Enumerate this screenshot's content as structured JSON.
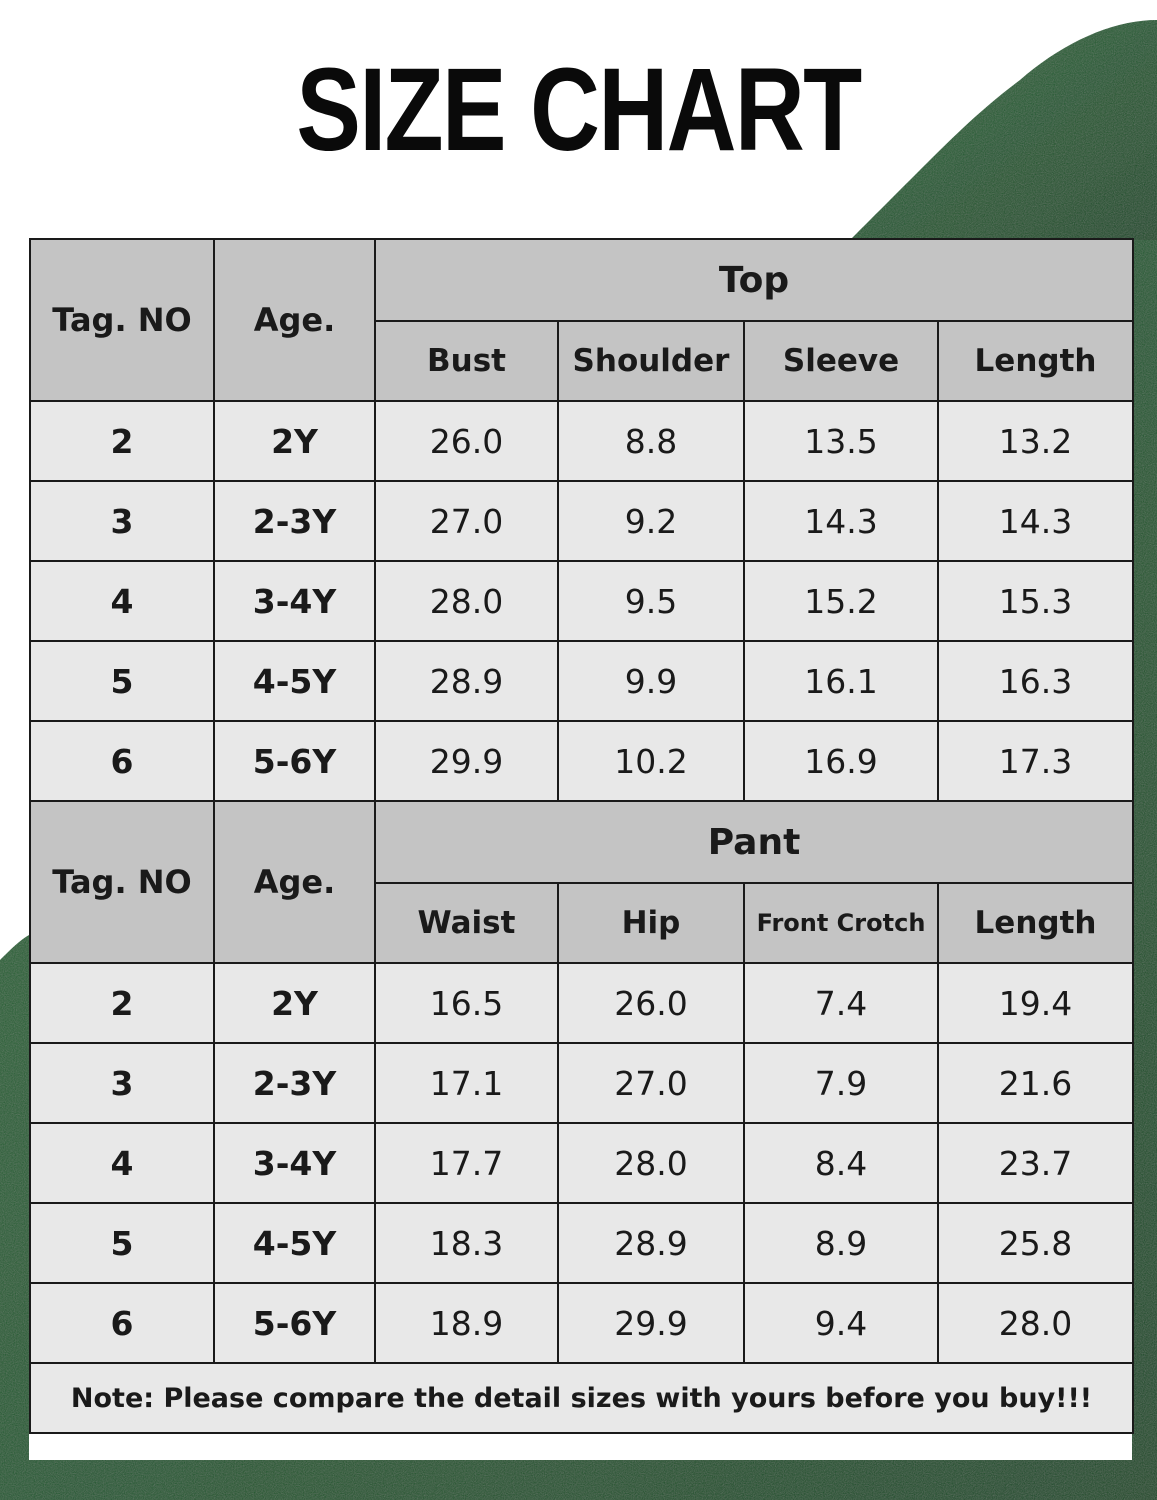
{
  "title": "SIZE CHART",
  "colors": {
    "header_bg": "#c4c4c4",
    "cell_bg": "#e8e8e8",
    "background_fleece": "#1e5a2e"
  },
  "top": {
    "group_label": "Top",
    "tag_header": "Tag. NO",
    "age_header": "Age.",
    "columns": [
      "Bust",
      "Shoulder",
      "Sleeve",
      "Length"
    ],
    "rows": [
      {
        "tag": "2",
        "age": "2Y",
        "values": [
          "26.0",
          "8.8",
          "13.5",
          "13.2"
        ]
      },
      {
        "tag": "3",
        "age": "2-3Y",
        "values": [
          "27.0",
          "9.2",
          "14.3",
          "14.3"
        ]
      },
      {
        "tag": "4",
        "age": "3-4Y",
        "values": [
          "28.0",
          "9.5",
          "15.2",
          "15.3"
        ]
      },
      {
        "tag": "5",
        "age": "4-5Y",
        "values": [
          "28.9",
          "9.9",
          "16.1",
          "16.3"
        ]
      },
      {
        "tag": "6",
        "age": "5-6Y",
        "values": [
          "29.9",
          "10.2",
          "16.9",
          "17.3"
        ]
      }
    ]
  },
  "pant": {
    "group_label": "Pant",
    "tag_header": "Tag. NO",
    "age_header": "Age.",
    "columns": [
      "Waist",
      "Hip",
      "Front Crotch",
      "Length"
    ],
    "rows": [
      {
        "tag": "2",
        "age": "2Y",
        "values": [
          "16.5",
          "26.0",
          "7.4",
          "19.4"
        ]
      },
      {
        "tag": "3",
        "age": "2-3Y",
        "values": [
          "17.1",
          "27.0",
          "7.9",
          "21.6"
        ]
      },
      {
        "tag": "4",
        "age": "3-4Y",
        "values": [
          "17.7",
          "28.0",
          "8.4",
          "23.7"
        ]
      },
      {
        "tag": "5",
        "age": "4-5Y",
        "values": [
          "18.3",
          "28.9",
          "8.9",
          "25.8"
        ]
      },
      {
        "tag": "6",
        "age": "5-6Y",
        "values": [
          "18.9",
          "29.9",
          "9.4",
          "28.0"
        ]
      }
    ]
  },
  "note": "Note: Please compare the detail sizes with yours before you buy!!!"
}
